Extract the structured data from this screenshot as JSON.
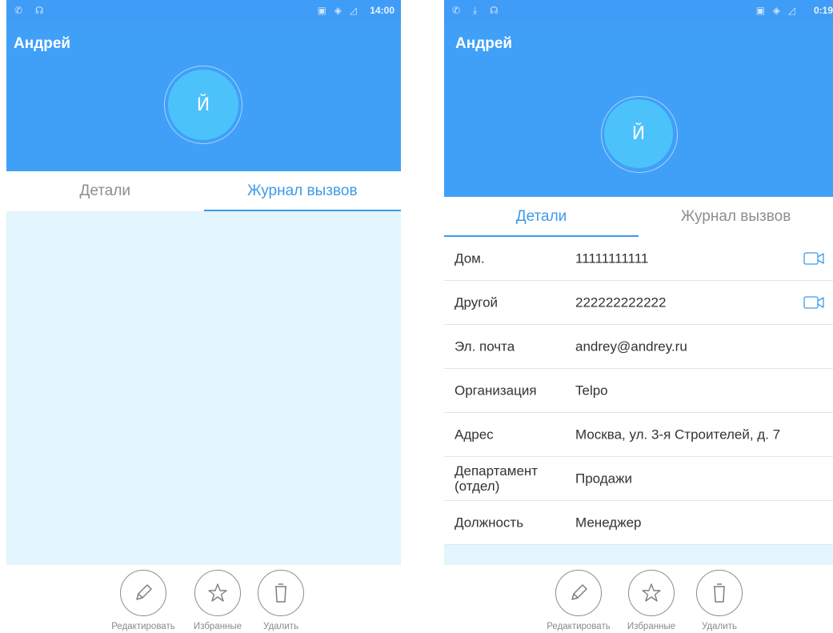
{
  "left_screen": {
    "status": {
      "left_icons": "✆ ☊",
      "sys_icons": "▣ ◈ ◿",
      "time": "14:00"
    },
    "contact_name": "Андрей",
    "avatar_letter": "Й",
    "tabs": [
      {
        "label": "Детали",
        "active": false
      },
      {
        "label": "Журнал вызвов",
        "active": true
      }
    ],
    "actions": [
      {
        "label": "Редактировать",
        "icon": "pencil-icon"
      },
      {
        "label": "Избранные",
        "icon": "star-icon"
      },
      {
        "label": "Удалить",
        "icon": "trash-icon"
      }
    ]
  },
  "right_screen": {
    "status": {
      "left_icons": "✆ ⤓ ☊",
      "sys_icons": "▣ ◈ ◿",
      "time": "0:19"
    },
    "contact_name": "Андрей",
    "avatar_letter": "Й",
    "tabs": [
      {
        "label": "Детали",
        "active": true
      },
      {
        "label": "Журнал вызвов",
        "active": false
      }
    ],
    "details": [
      {
        "label": "Дом.",
        "value": "11111111111",
        "video_call": true
      },
      {
        "label": "Другой",
        "value": "222222222222",
        "video_call": true
      },
      {
        "label": "Эл. почта",
        "value": "andrey@andrey.ru",
        "video_call": false
      },
      {
        "label": "Организация",
        "value": "Telpo",
        "video_call": false
      },
      {
        "label": "Адрес",
        "value": "Москва, ул. 3-я Строителей, д. 7",
        "video_call": false
      },
      {
        "label": "Департамент (отдел)",
        "value": "Продажи",
        "video_call": false
      },
      {
        "label": "Должность",
        "value": "Менеджер",
        "video_call": false
      }
    ],
    "actions": [
      {
        "label": "Редактировать",
        "icon": "pencil-icon"
      },
      {
        "label": "Избранные",
        "icon": "star-icon"
      },
      {
        "label": "Удалить",
        "icon": "trash-icon"
      }
    ]
  },
  "colors": {
    "header_blue": "#40a0f8",
    "avatar_blue": "#4cc2fb",
    "accent": "#3d9be9",
    "content_bg": "#e3f5fd"
  }
}
